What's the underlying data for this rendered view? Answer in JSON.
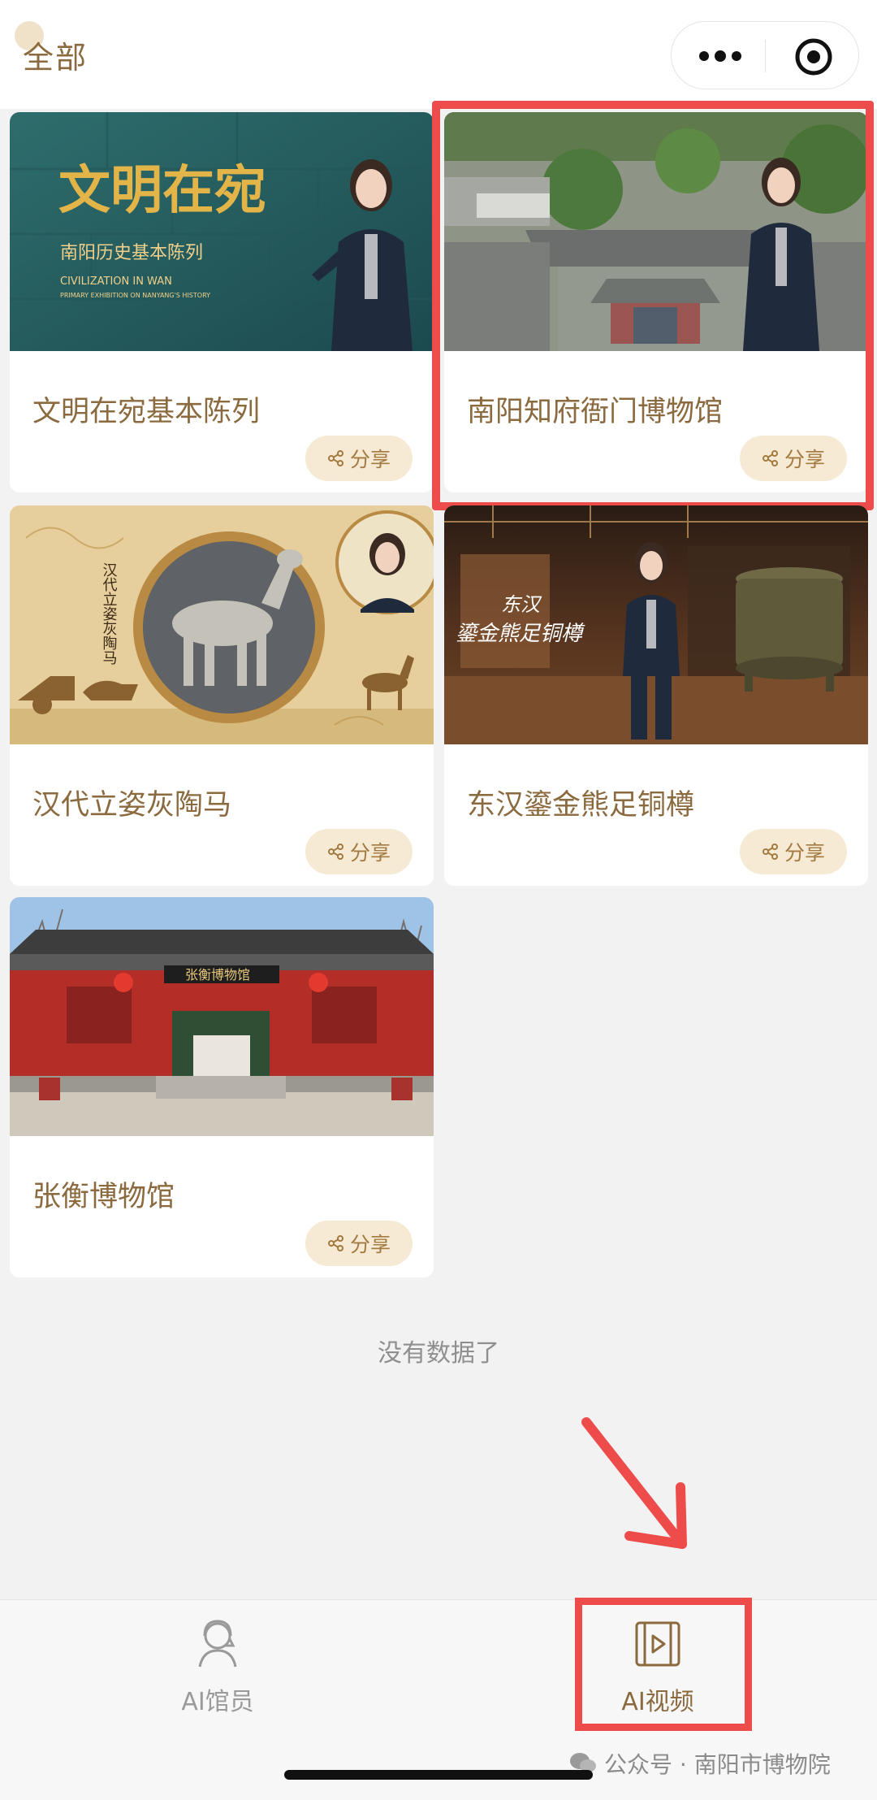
{
  "header": {
    "title": "全部"
  },
  "cards": [
    {
      "title": "文明在宛基本陈列",
      "share_label": "分享",
      "thumb_text": {
        "main": "文明在宛",
        "sub": "南阳历史基本陈列",
        "en1": "CIVILIZATION IN WAN",
        "en2": "PRIMARY EXHIBITION ON NANYANG'S HISTORY"
      }
    },
    {
      "title": "南阳知府衙门博物馆",
      "share_label": "分享"
    },
    {
      "title": "汉代立姿灰陶马",
      "share_label": "分享",
      "thumb_text": {
        "vertical": "汉代立姿灰陶马"
      }
    },
    {
      "title": "东汉鎏金熊足铜樽",
      "share_label": "分享",
      "thumb_text": {
        "line1": "东汉",
        "line2": "鎏金熊足铜樽"
      }
    },
    {
      "title": "张衡博物馆",
      "share_label": "分享",
      "thumb_text": {
        "sign": "张衡博物馆"
      }
    }
  ],
  "list_end_text": "没有数据了",
  "tabbar": {
    "tabs": [
      {
        "label": "AI馆员",
        "icon": "curator-icon",
        "active": false
      },
      {
        "label": "AI视频",
        "icon": "video-icon",
        "active": true
      }
    ]
  },
  "watermark": {
    "text": "公众号 · 南阳市博物院",
    "icon": "wechat-icon"
  },
  "colors": {
    "accent": "#8a6a3e",
    "share_bg": "#f6ead4",
    "annotation": "#ee4b4b"
  }
}
